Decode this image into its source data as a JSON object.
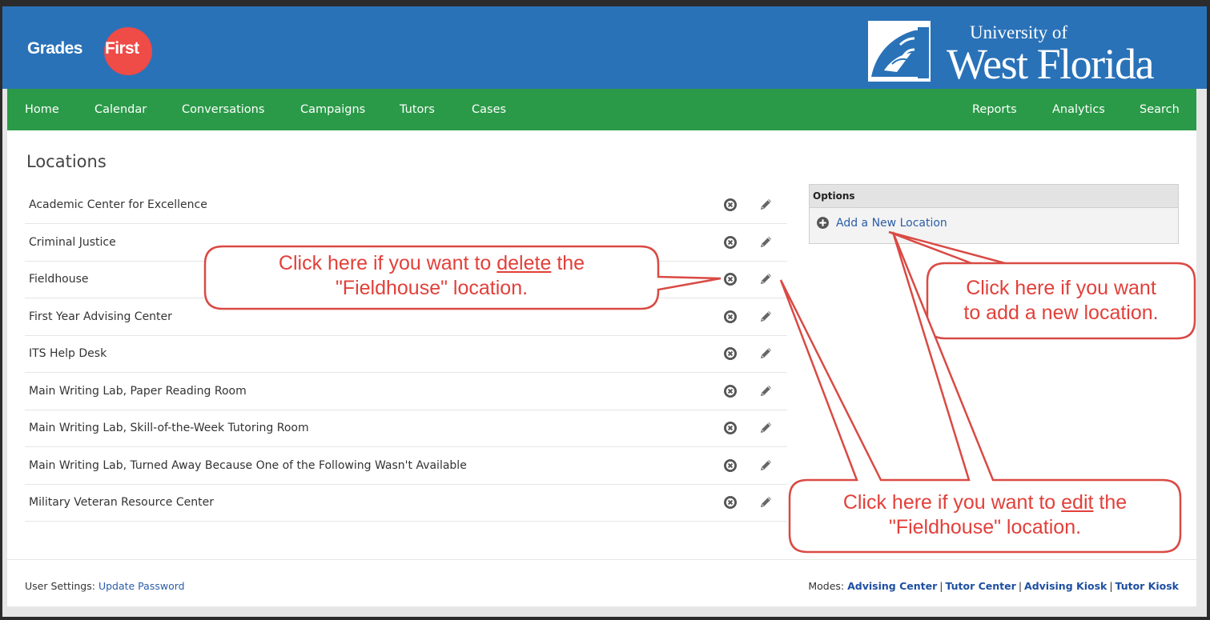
{
  "header": {
    "logo_grades": "Grades",
    "logo_first": "First",
    "university_line1": "University of",
    "university_line2": "West Florida",
    "colors": {
      "header_bg": "#2a72b8",
      "nav_bg": "#2a9a48",
      "logo_circle": "#ef4b47",
      "callout": "#e2403a"
    }
  },
  "nav": {
    "left": [
      {
        "label": "Home"
      },
      {
        "label": "Calendar"
      },
      {
        "label": "Conversations"
      },
      {
        "label": "Campaigns"
      },
      {
        "label": "Tutors"
      },
      {
        "label": "Cases"
      }
    ],
    "right": [
      {
        "label": "Reports"
      },
      {
        "label": "Analytics"
      },
      {
        "label": "Search"
      }
    ]
  },
  "page": {
    "title": "Locations",
    "locations": [
      {
        "name": "Academic Center for Excellence"
      },
      {
        "name": "Criminal Justice"
      },
      {
        "name": "Fieldhouse"
      },
      {
        "name": "First Year Advising Center"
      },
      {
        "name": "ITS Help Desk"
      },
      {
        "name": "Main Writing Lab, Paper Reading Room"
      },
      {
        "name": "Main Writing Lab, Skill-of-the-Week Tutoring Room"
      },
      {
        "name": "Main Writing Lab, Turned Away Because One of the Following Wasn't Available"
      },
      {
        "name": "Military Veteran Resource Center"
      }
    ],
    "row_icons": {
      "delete": "circle-x-icon",
      "edit": "pencil-icon"
    }
  },
  "options": {
    "title": "Options",
    "add_label": "Add a New Location",
    "add_icon": "plus-circle-icon"
  },
  "footer": {
    "user_settings_label": "User Settings:",
    "update_password": "Update Password",
    "modes_label": "Modes:",
    "modes": [
      "Advising Center",
      "Tutor Center",
      "Advising Kiosk",
      "Tutor Kiosk"
    ],
    "separator": "|"
  },
  "callouts": {
    "delete": {
      "pre": "Click here if you want to ",
      "em": "delete",
      "post": " the",
      "line2": "\"Fieldhouse\" location."
    },
    "add": {
      "line1": "Click here if you want",
      "line2": "to add a new location."
    },
    "edit": {
      "pre": "Click here if you want to ",
      "em": "edit",
      "post": " the",
      "line2": "\"Fieldhouse\" location."
    }
  }
}
